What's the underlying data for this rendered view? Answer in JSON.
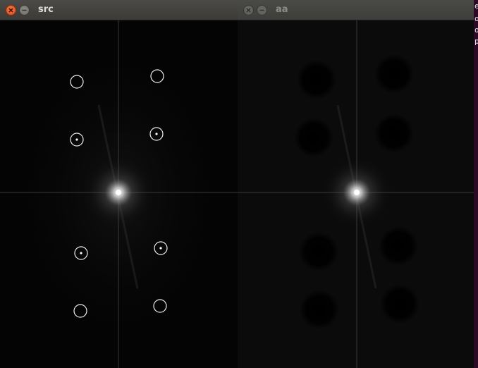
{
  "windows": [
    {
      "title": "src",
      "state": "active"
    },
    {
      "title": "aa",
      "state": "inactive"
    }
  ],
  "icons": {
    "close": "close-icon",
    "minimize": "minimize-icon"
  },
  "terminal_edge": [
    "e",
    "o",
    "o",
    "p"
  ],
  "colors": {
    "desktop": "#2c0a25",
    "close_active": "#df4a16",
    "titlebar": "#3c3b37"
  }
}
